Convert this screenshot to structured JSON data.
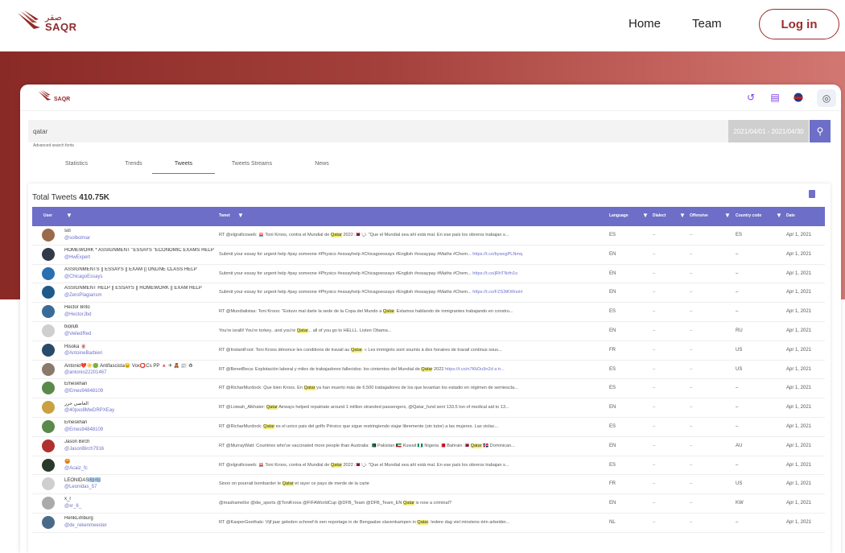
{
  "nav": {
    "logo_ar": "صقر",
    "logo_en": "SAQR",
    "home": "Home",
    "team": "Team",
    "login": "Log in"
  },
  "card": {
    "logo_en": "SAQR"
  },
  "search": {
    "value": "qatar",
    "date_range": "2021/04/01 - 2021/04/30",
    "advanced": "Advanced search fonts"
  },
  "tabs": [
    "Statistics",
    "Trends",
    "Tweets",
    "Tweets Streams",
    "News"
  ],
  "total": {
    "label": "Total Tweets",
    "value": "410.75K"
  },
  "columns": [
    "User",
    "Tweet",
    "Language",
    "Dialect",
    "Offensive",
    "Country code",
    "Date"
  ],
  "rows": [
    {
      "name": "sol",
      "handle": "@solbolmar",
      "tweet": [
        "RT @elgraficoweb: 🚨 Toni Kroos, contra el Mundial de ",
        "Qatar",
        " 2022 🇶🇦 🗣 \"Que el Mundial sea ahí está mal. En ese país los obreros trabajan s..."
      ],
      "link": "",
      "lang": "ES",
      "dialect": "–",
      "off": "–",
      "cc": "ES",
      "date": "Apr 1, 2021",
      "color": "#9a6a4a"
    },
    {
      "name": "HOMEWORK * ASSIGNMENT \"ESSAYS \"ECONOMIC EXAMS HELP",
      "handle": "@HwExpert",
      "tweet": [
        "Submit your essay for urgent help #pay someone #Physics #essayhelp #Chicagoessays #English #essaypay #Maths #Chem... ",
        "",
        ""
      ],
      "link": "https://t.co/bywcgPLNmq",
      "lang": "EN",
      "dialect": "–",
      "off": "–",
      "cc": "–",
      "date": "Apr 1, 2021",
      "color": "#333a4a"
    },
    {
      "name": "ASSIGNMENTS || ESSAYS || EXAM || ONLINE CLASS HELP",
      "handle": "@ChicagoEssays",
      "tweet": [
        "Submit your essay for urgent help #pay someone #Physics #essayhelp #Chicagoessays #English #essaypay #Maths #Chem... ",
        "",
        ""
      ],
      "link": "https://t.co/jRhTNrfn1o",
      "lang": "EN",
      "dialect": "–",
      "off": "–",
      "cc": "–",
      "date": "Apr 1, 2021",
      "color": "#2a6fb0"
    },
    {
      "name": "ASSIGNMENT HELP || ESSAYS || HOMEWORK || EXAM HELP",
      "handle": "@ZeroPlagiarism",
      "tweet": [
        "Submit your essay for urgent help #pay someone #Physics #essayhelp #Chicagoessays #English #essaypay #Maths #Chem... ",
        "",
        ""
      ],
      "link": "https://t.co/FZS3tKWnoH",
      "lang": "EN",
      "dialect": "–",
      "off": "–",
      "cc": "–",
      "date": "Apr 1, 2021",
      "color": "#1e5a8a"
    },
    {
      "name": "Hector Brito",
      "handle": "@HectorJbd",
      "tweet": [
        "RT @Mundialistas: Toni Kroos: \"Estuvo mal darle la sede de la Copa del Mundo a ",
        "Qatar",
        ". Estamos hablando de inmigrantes trabajando en constru..."
      ],
      "link": "",
      "lang": "ES",
      "dialect": "–",
      "off": "–",
      "cc": "–",
      "date": "Apr 1, 2021",
      "color": "#3a6a9a"
    },
    {
      "name": "bịọịlụb",
      "handle": "@VeiledRed",
      "tweet": [
        "You're isralli! You're torkey.. and you're ",
        "Qatar",
        "... all of you go to HELLL. Listen Obama..."
      ],
      "link": "",
      "lang": "EN",
      "dialect": "–",
      "off": "–",
      "cc": "RU",
      "date": "Apr 1, 2021",
      "color": "#cfcfcf"
    },
    {
      "name": "Hisoka 🀄",
      "handle": "@AntoineBarbieri",
      "tweet": [
        "RT @InstantFoot: Toni Kroos dénonce les conditions de travail au ",
        "Qatar",
        ". « Les immigrés sont soumis à des horaires de travail continus sous..."
      ],
      "link": "",
      "lang": "FR",
      "dialect": "–",
      "off": "–",
      "cc": "US",
      "date": "Apr 1, 2021",
      "color": "#2a4a6a"
    },
    {
      "name": "Antonio❤️☀️🟢 Antifascista😠 Vox⭕Cs PP 🔺 ✈ 🧸 📰 ♻",
      "handle": "@antonio22201467",
      "tweet": [
        "RT @BenetBeca: Explotación laboral y miles de trabajadores fallecidos: los cimientos del Mundial de ",
        "Qatar",
        " 2022 "
      ],
      "link": "https://t.co/n7KkDu9n2d a tr...",
      "lang": "ES",
      "dialect": "–",
      "off": "–",
      "cc": "US",
      "date": "Apr 1, 2021",
      "color": "#8a7a6a"
    },
    {
      "name": "Emeskhan",
      "handle": "@Emes94848109",
      "tweet": [
        "RT @RicharMurdock: Que bien Kroos. En ",
        "Qatar",
        " ya han muerto más de 6.500 trabajadores de los que levantan los estadio en régimen de semiescla..."
      ],
      "link": "",
      "lang": "ES",
      "dialect": "–",
      "off": "–",
      "cc": "–",
      "date": "Apr 1, 2021",
      "color": "#5a8a4a"
    },
    {
      "name": "العاصي حرز",
      "handle": "@40pxo8MwDRPXEay",
      "tweet": [
        "RT @Loiwah_Alkhater: ",
        "Qatar",
        " Airways helped repatriate around 1 million stranded passengers, @Qatar_fund sent 133.5 ton of medical aid to 13..."
      ],
      "link": "",
      "lang": "EN",
      "dialect": "–",
      "off": "–",
      "cc": "–",
      "date": "Apr 1, 2021",
      "color": "#caa040"
    },
    {
      "name": "Emeskhan",
      "handle": "@Emes94848109",
      "tweet": [
        "RT @RicharMurdock: ",
        "Qatar",
        " es el unico pais del golfo Pérsico que sigue restringiendo viajar libremente (sin tutor) a las mujeres. Las violac..."
      ],
      "link": "",
      "lang": "ES",
      "dialect": "–",
      "off": "–",
      "cc": "–",
      "date": "Apr 1, 2021",
      "color": "#5a8a4a"
    },
    {
      "name": "Jason Birch",
      "handle": "@JasonBirch7916",
      "tweet": [
        "RT @MurrayWatt: Countries who've vaccinated more people than Australia: 🇵🇰 Pakistan 🇰🇼 Kuwait 🇳🇬 Nigeria 🇧🇭 Bahrain 🇶🇦 ",
        "Qatar",
        " 🇩🇴 Dominican..."
      ],
      "link": "",
      "lang": "EN",
      "dialect": "–",
      "off": "–",
      "cc": "AU",
      "date": "Apr 1, 2021",
      "color": "#b03030"
    },
    {
      "name": "😡",
      "handle": "@Acaiz_fc",
      "tweet": [
        "RT @elgraficoweb: 🚨 Toni Kroos, contra el Mundial de ",
        "Qatar",
        " 2022 🇶🇦 🗣 \"Que el Mundial sea ahí está mal. En ese país los obreros trabajan s..."
      ],
      "link": "",
      "lang": "ES",
      "dialect": "–",
      "off": "–",
      "cc": "–",
      "date": "Apr 1, 2021",
      "color": "#2a3a2a"
    },
    {
      "name": "LEONIDAS🇬🇷🇬🇷",
      "handle": "@Leonidas_57",
      "tweet": [
        "Sinon on pourrait bombarder le ",
        "Qatar",
        " et rayer ce pays de merde de la carte"
      ],
      "link": "",
      "lang": "FR",
      "dialect": "–",
      "off": "–",
      "cc": "US",
      "date": "Apr 1, 2021",
      "color": "#cfcfcf"
    },
    {
      "name": "x_r",
      "handle": "@xr_6_",
      "tweet": [
        "@mashamellor @dw_sports @ToniKroos @FIFAWorldCup @DFB_Team @DFB_Team_EN ",
        "Qatar",
        " is now a criminal?"
      ],
      "link": "",
      "lang": "EN",
      "dialect": "–",
      "off": "–",
      "cc": "KW",
      "date": "Apr 1, 2021",
      "color": "#aaaaaa"
    },
    {
      "name": "HenkLimburg",
      "handle": "@de_rekenmeester",
      "tweet": [
        "RT @KasperGoethals: Vijf jaar geleden schreef ik een reportage in de Bengaalse slavenkampen in ",
        "Qatar",
        ". Iedere dag viel minstens één arbeider..."
      ],
      "link": "",
      "lang": "NL",
      "dialect": "–",
      "off": "–",
      "cc": "–",
      "date": "Apr 1, 2021",
      "color": "#4a6a8a"
    }
  ]
}
